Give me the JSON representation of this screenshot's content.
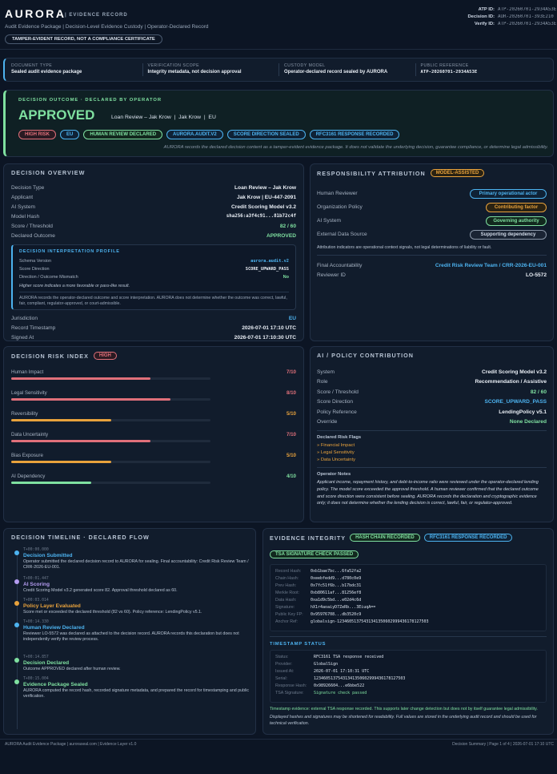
{
  "brand": {
    "name": "AURORA",
    "sub": "EVIDENCE RECORD",
    "tagline": [
      "Audit Evidence Package",
      "Decision-Level Evidence Custody",
      "Operator-Declared Record"
    ],
    "notice": "TAMPER-EVIDENT RECORD, NOT A COMPLIANCE CERTIFICATE"
  },
  "ids": [
    {
      "k": "ATP ID:",
      "v": "ATP-20260701-2934A53E"
    },
    {
      "k": "Decision ID:",
      "v": "AUR-20260701-393E210"
    },
    {
      "k": "Verify ID:",
      "v": "ATP-20260701-2934A53E"
    }
  ],
  "meta": [
    {
      "k": "DOCUMENT TYPE",
      "v": "Sealed audit evidence package"
    },
    {
      "k": "VERIFICATION SCOPE",
      "v": "Integrity metadata, not decision approval"
    },
    {
      "k": "CUSTODY MODEL",
      "v": "Operator-declared record sealed by AURORA"
    },
    {
      "k": "PUBLIC REFERENCE",
      "v": "ATP-20260701-2934A53E"
    }
  ],
  "outcome": {
    "label": "DECISION OUTCOME · DECLARED BY OPERATOR",
    "status": "APPROVED",
    "context": [
      "Loan Review – Jak Krow",
      "Jak Krow",
      "EU"
    ],
    "tags": [
      "HIGH RISK",
      "EU",
      "HUMAN REVIEW DECLARED",
      "AURORA.AUDIT.V2",
      "SCORE DIRECTION SEALED",
      "RFC3161 RESPONSE RECORDED"
    ],
    "note": "AURORA records the declared decision content as a tamper-evident evidence package. It does not validate the underlying decision, guarantee compliance, or determine legal admissibility."
  },
  "overview": {
    "title": "DECISION OVERVIEW",
    "rows": [
      {
        "k": "Decision Type",
        "v": "Loan Review – Jak Krow"
      },
      {
        "k": "Applicant",
        "v": "Jak Krow | EU-447-2091"
      },
      {
        "k": "AI System",
        "v": "Credit Scoring Model v3.2"
      },
      {
        "k": "Model Hash",
        "v": "sha256:a3f4c91...81b72c4f"
      },
      {
        "k": "Score / Threshold",
        "v": "82 / 60"
      },
      {
        "k": "Declared Outcome",
        "v": "APPROVED"
      }
    ],
    "profile": {
      "title": "DECISION INTERPRETATION PROFILE",
      "rows": [
        {
          "k": "Schema Version",
          "v": "aurora.audit.v2"
        },
        {
          "k": "Score Direction",
          "v": "SCORE_UPWARD_PASS"
        },
        {
          "k": "Direction / Outcome Mismatch",
          "v": "No"
        }
      ],
      "hint": "Higher score indicates a more favorable or pass-like result.",
      "note": "AURORA records the operator-declared outcome and score interpretation. AURORA does not determine whether the outcome was correct, lawful, fair, compliant, regulator-approved, or court-admissible."
    },
    "rows2": [
      {
        "k": "Jurisdiction",
        "v": "EU"
      },
      {
        "k": "Record Timestamp",
        "v": "2026-07-01 17:10 UTC"
      },
      {
        "k": "Signed At",
        "v": "2026-07-01 17:10:30 UTC"
      }
    ]
  },
  "resp": {
    "title": "RESPONSIBILITY ATTRIBUTION",
    "badge": "MODEL-ASSISTED",
    "rows": [
      {
        "k": "Human Reviewer",
        "v": "Primary operational actor"
      },
      {
        "k": "Organization Policy",
        "v": "Contributing factor"
      },
      {
        "k": "AI System",
        "v": "Governing authority"
      },
      {
        "k": "External Data Source",
        "v": "Supporting dependency"
      }
    ],
    "note": "Attribution indicators are operational context signals, not legal determinations of liability or fault.",
    "final": [
      {
        "k": "Final Accountability",
        "v": "Credit Risk Review Team / CRR-2026-EU-001"
      },
      {
        "k": "Reviewer ID",
        "v": "LO-5572"
      }
    ]
  },
  "risk": {
    "title": "DECISION RISK INDEX",
    "badge": "HIGH",
    "items": [
      {
        "k": "Human Impact",
        "v": "7/10",
        "n": 0.7,
        "c": "#e0707a"
      },
      {
        "k": "Legal Sensitivity",
        "v": "8/10",
        "n": 0.8,
        "c": "#e0707a"
      },
      {
        "k": "Reversibility",
        "v": "5/10",
        "n": 0.5,
        "c": "#e8a23c"
      },
      {
        "k": "Data Uncertainty",
        "v": "7/10",
        "n": 0.7,
        "c": "#e0707a"
      },
      {
        "k": "Bias Exposure",
        "v": "5/10",
        "n": 0.5,
        "c": "#e8a23c"
      },
      {
        "k": "AI Dependency",
        "v": "4/10",
        "n": 0.4,
        "c": "#7fe0a0"
      }
    ]
  },
  "ai": {
    "title": "AI / POLICY CONTRIBUTION",
    "rows": [
      {
        "k": "System",
        "v": "Credit Scoring Model v3.2"
      },
      {
        "k": "Role",
        "v": "Recommendation / Assistive"
      },
      {
        "k": "Score / Threshold",
        "v": "82 / 60"
      },
      {
        "k": "Score Direction",
        "v": "SCORE_UPWARD_PASS"
      },
      {
        "k": "Policy Reference",
        "v": "LendingPolicy v5.1"
      },
      {
        "k": "Override",
        "v": "None Declared"
      }
    ],
    "flags_title": "Declared Risk Flags",
    "flags": [
      "Financial Impact",
      "Legal Sensitivity",
      "Data Uncertainty"
    ],
    "notes_title": "Operator Notes",
    "notes": "Applicant income, repayment history, and debt-to-income ratio were reviewed under the operator-declared lending policy. The model score exceeded the approval threshold. A human reviewer confirmed that the declared outcome and score direction were consistent before sealing. AURORA records the declaration and cryptographic evidence only; it does not determine whether the lending decision is correct, lawful, fair, or regulator-approved."
  },
  "timeline": {
    "title": "DECISION TIMELINE · DECLARED FLOW",
    "events": [
      {
        "t": "T+00:00.000",
        "h": "Decision Submitted",
        "c": "#4db3f0",
        "d": "Operator submitted the declared decision record to AURORA for sealing. Final accountability: Credit Risk Review Team / CRR-2026-EU-001."
      },
      {
        "t": "T+00:01.447",
        "h": "AI Scoring",
        "c": "#b49cf0",
        "d": "Credit Scoring Model v3.2 generated score 82. Approval threshold declared as 60."
      },
      {
        "t": "T+00:03.014",
        "h": "Policy Layer Evaluated",
        "c": "#e8a23c",
        "d": "Score met or exceeded the declared threshold (82 vs 60). Policy reference: LendingPolicy v5.1."
      },
      {
        "t": "T+00:14.330",
        "h": "Human Review Declared",
        "c": "#4db3f0",
        "d": "Reviewer LO-5572 was declared as attached to the decision record. AURORA records this declaration but does not independently verify the review process."
      },
      {
        "t": "T+00:14.857",
        "h": "Decision Declared",
        "c": "#7fe0a0",
        "d": "Outcome APPROVED declared after human review."
      },
      {
        "t": "T+00:15.004",
        "h": "Evidence Package Sealed",
        "c": "#7fe0a0",
        "d": "AURORA computed the record hash, recorded signature metadata, and prepared the record for timestamping and public verification."
      }
    ]
  },
  "integrity": {
    "title": "EVIDENCE INTEGRITY",
    "badges": [
      "HASH CHAIN RECORDED",
      "RFC3161 RESPONSE RECORDED",
      "TSA SIGNATURE CHECK PASSED"
    ],
    "rows": [
      {
        "k": "Record Hash:",
        "v": "0xb1bae7bc...6fa52fa2"
      },
      {
        "k": "Chain Hash:",
        "v": "0xeebfedd9...d780c0e9"
      },
      {
        "k": "Prev Hash:",
        "v": "0x7fc51f6b...b17bdc31"
      },
      {
        "k": "Merkle Root:",
        "v": "0xb80611af...81256ef8"
      },
      {
        "k": "Data Hash:",
        "v": "0xa1d9c5bd...e02d4c6d"
      },
      {
        "k": "Signature:",
        "v": "hX1r4aoaiyD7ZeRb...3EiuqA=="
      },
      {
        "k": "Public Key FP:",
        "v": "0x95976708...db3520c9"
      },
      {
        "k": "Anchor Ref:",
        "v": "globalsign-12346051375431341350602999436178127503"
      }
    ],
    "ts_title": "TIMESTAMP STATUS",
    "ts": [
      {
        "k": "Status:",
        "v": "RFC3161 TSA response received"
      },
      {
        "k": "Provider:",
        "v": "GlobalSign"
      },
      {
        "k": "Issued At:",
        "v": "2026-07-01 17:10:31 UTC"
      },
      {
        "k": "Serial:",
        "v": "12346051375431341350602999436178127503"
      },
      {
        "k": "Response Hash:",
        "v": "0x98926604...e6bbe522"
      },
      {
        "k": "TSA Signature:",
        "v": "Signature check passed"
      }
    ],
    "ev": "Timestamp evidence: external TSA response recorded. This supports later change detection but does not by itself guarantee legal admissibility.",
    "disp": "Displayed hashes and signatures may be shortened for readability. Full values are stored in the underlying audit record and should be used for technical verification."
  },
  "footer": {
    "left": "AURORA Audit Evidence Package  |  auroraseal.com  |  Evidence Layer v1.0",
    "right": "Decision Summary  |  Page 1 of 4  |  2026-07-01 17:10 UTC"
  },
  "colors": {
    "bg": "#0c1524",
    "card": "#111c2c",
    "green": "#7fe0a0",
    "blue": "#4db3f0",
    "amber": "#e8a23c",
    "red": "#e0707a"
  }
}
